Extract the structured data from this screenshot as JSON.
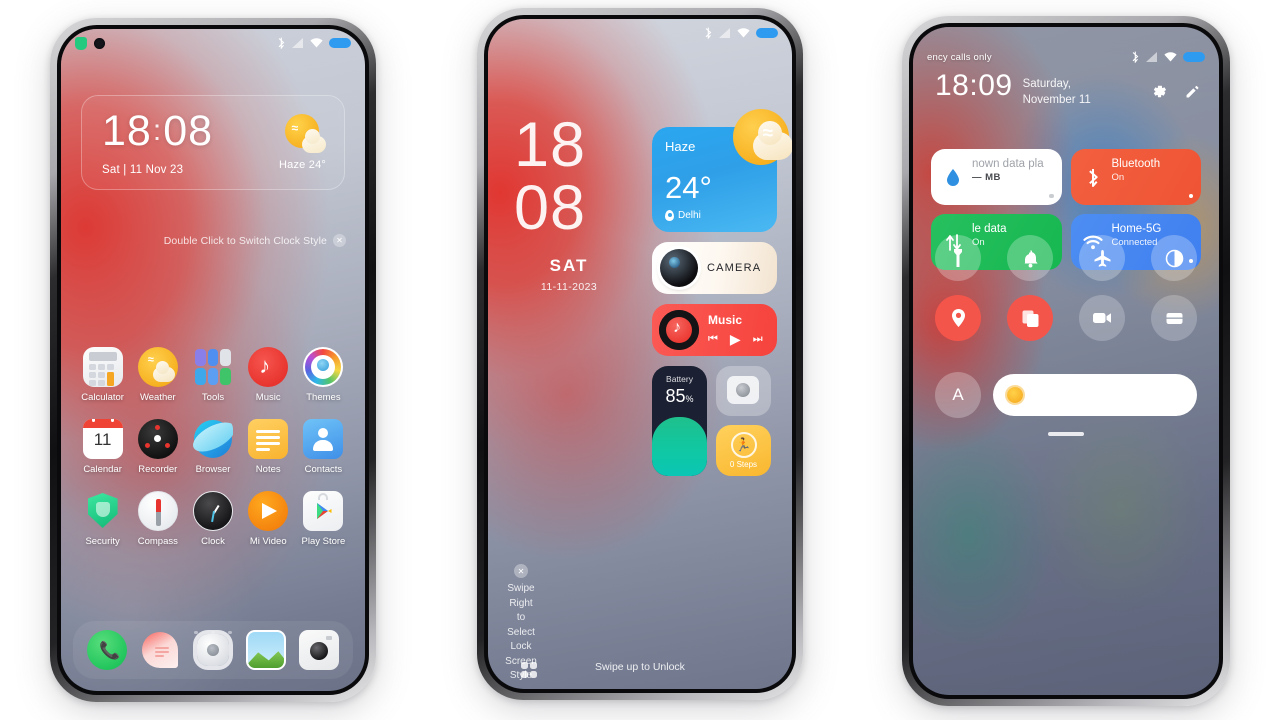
{
  "phone1": {
    "name": "home-screen-phone",
    "status_bar": {
      "security_icon": "shield-icon",
      "camera_punch_hole": "camera-punch-hole",
      "icons": [
        "bluetooth-icon",
        "signal-icon",
        "wifi-icon",
        "battery-icon"
      ]
    },
    "clock_widget": {
      "hours": "18",
      "colon": ":",
      "minutes": "08",
      "date": "Sat | 11 Nov 23",
      "weather": "Haze 24°"
    },
    "hint": {
      "text": "Double Click to Switch Clock Style",
      "close": "✕"
    },
    "apps_row1": [
      {
        "label": "Calculator",
        "icon": "calculator-icon"
      },
      {
        "label": "Weather",
        "icon": "weather-icon"
      },
      {
        "label": "Tools",
        "icon": "tools-folder-icon"
      },
      {
        "label": "Music",
        "icon": "music-icon"
      },
      {
        "label": "Themes",
        "icon": "themes-icon"
      }
    ],
    "apps_row2": [
      {
        "label": "Calendar",
        "icon": "calendar-icon",
        "day": "11"
      },
      {
        "label": "Recorder",
        "icon": "recorder-icon"
      },
      {
        "label": "Browser",
        "icon": "browser-icon"
      },
      {
        "label": "Notes",
        "icon": "notes-icon"
      },
      {
        "label": "Contacts",
        "icon": "contacts-icon"
      }
    ],
    "apps_row3": [
      {
        "label": "Security",
        "icon": "security-icon"
      },
      {
        "label": "Compass",
        "icon": "compass-icon"
      },
      {
        "label": "Clock",
        "icon": "clock-icon"
      },
      {
        "label": "Mi Video",
        "icon": "mi-video-icon"
      },
      {
        "label": "Play Store",
        "icon": "play-store-icon"
      }
    ],
    "dock": [
      {
        "name": "phone-icon"
      },
      {
        "name": "messages-icon"
      },
      {
        "name": "settings-icon"
      },
      {
        "name": "gallery-icon"
      },
      {
        "name": "camera-icon"
      }
    ]
  },
  "phone2": {
    "name": "lock-screen-phone",
    "status_bar": {
      "icons": [
        "bluetooth-icon",
        "signal-icon",
        "wifi-icon",
        "battery-icon"
      ]
    },
    "clock": {
      "hours": "18",
      "minutes": "08",
      "weekday": "SAT",
      "date": "11-11-2023"
    },
    "weather_widget": {
      "condition": "Haze",
      "temperature": "24°",
      "city": "Delhi"
    },
    "camera_widget": {
      "label": "CAMERA"
    },
    "music_widget": {
      "title": "Music",
      "prev": "⏮",
      "play": "▶",
      "next": "⏭"
    },
    "battery_widget": {
      "label": "Battery",
      "value": "85",
      "unit": "%"
    },
    "steps_widget": {
      "label": "0 Steps"
    },
    "swipe_style_hint": {
      "close": "✕",
      "lines": [
        "Swipe",
        "Right",
        "to",
        "Select",
        "Lock",
        "Screen",
        "Style"
      ]
    },
    "unlock_text": "Swipe up to Unlock"
  },
  "phone3": {
    "name": "control-center-phone",
    "status_bar": {
      "carrier": "ency calls only",
      "icons": [
        "bluetooth-icon",
        "signal-icon",
        "wifi-icon",
        "battery-icon"
      ]
    },
    "header": {
      "time": "18:09",
      "date": "Saturday, November 11",
      "settings_icon": "gear-icon",
      "edit_icon": "pencil-icon"
    },
    "tiles": [
      {
        "name": "data-usage-tile",
        "title": "nown data pla",
        "subtitle": "— MB",
        "icon": "water-drop-icon"
      },
      {
        "name": "bluetooth-tile",
        "title": "Bluetooth",
        "subtitle": "On",
        "icon": "bluetooth-icon"
      },
      {
        "name": "mobile-data-tile",
        "title": "le data",
        "subtitle": "On",
        "icon": "data-transfer-icon"
      },
      {
        "name": "wifi-tile",
        "title": "Home-5G",
        "subtitle": "Connected",
        "icon": "wifi-icon"
      }
    ],
    "toggles_row1": [
      {
        "name": "flashlight-toggle",
        "icon": "flashlight-icon",
        "state": "off"
      },
      {
        "name": "sound-toggle",
        "icon": "bell-icon",
        "state": "off"
      },
      {
        "name": "airplane-mode-toggle",
        "icon": "airplane-icon",
        "state": "off"
      },
      {
        "name": "dark-mode-toggle",
        "icon": "half-circle-icon",
        "state": "off"
      }
    ],
    "toggles_row2": [
      {
        "name": "location-toggle",
        "icon": "location-pin-icon",
        "state": "on"
      },
      {
        "name": "screenshot-toggle",
        "icon": "copy-icon",
        "state": "on"
      },
      {
        "name": "screen-record-toggle",
        "icon": "video-camera-icon",
        "state": "off"
      },
      {
        "name": "cast-toggle",
        "icon": "cast-icon",
        "state": "off"
      }
    ],
    "brightness": {
      "auto_label": "A",
      "icon": "sun-icon"
    }
  },
  "colors": {
    "accent_red": "#e8342e",
    "bluetooth_tile": "#f2603f",
    "mobile_data_tile": "#27c060",
    "wifi_tile": "#4d8ef2",
    "battery_green": "#0fc8a4",
    "weather_blue": "#2aa7f0",
    "status_blue": "#2f9bf0",
    "security_green": "#23c97f"
  }
}
